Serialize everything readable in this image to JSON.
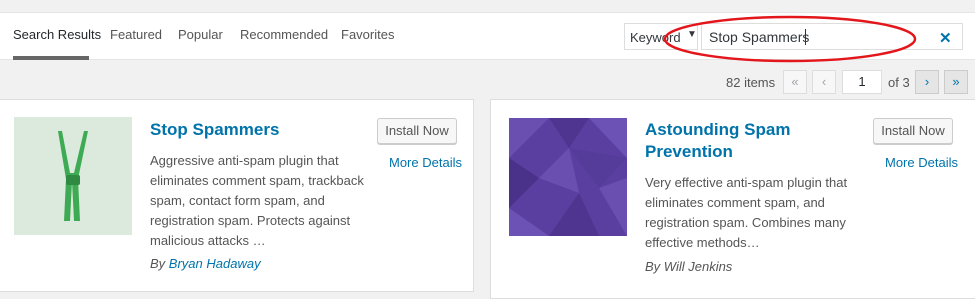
{
  "tabs": [
    {
      "label": "Search Results",
      "active": true
    },
    {
      "label": "Featured",
      "active": false
    },
    {
      "label": "Popular",
      "active": false
    },
    {
      "label": "Recommended",
      "active": false
    },
    {
      "label": "Favorites",
      "active": false
    }
  ],
  "search": {
    "type_selected": "Keyword",
    "value": "Stop Spammers",
    "clear_icon": "close-icon"
  },
  "pagination": {
    "items_count": "82 items",
    "first": "«",
    "prev": "‹",
    "current_page": "1",
    "of_pages": "of 3",
    "next": "›",
    "last": "»"
  },
  "plugins": [
    {
      "title": "Stop Spammers",
      "description_lines": [
        "Aggressive anti-spam plugin that",
        "eliminates comment spam, trackback",
        "spam, contact form spam, and",
        "registration spam. Protects against",
        "malicious attacks …"
      ],
      "author_prefix": "By",
      "author": "Bryan Hadaway",
      "install_label": "Install Now",
      "more_details": "More Details",
      "thumbnail_icon": "suspenders-icon"
    },
    {
      "title_lines": [
        "Astounding Spam",
        "Prevention"
      ],
      "description_lines": [
        "Very effective anti-spam plugin that",
        "eliminates comment spam, and",
        "registration spam. Combines many",
        "effective methods…"
      ],
      "author_prefix": "By",
      "author": "Will Jenkins",
      "install_label": "Install Now",
      "more_details": "More Details",
      "thumbnail_icon": "geometric-pattern-icon"
    }
  ],
  "colors": {
    "link": "#0073aa",
    "highlight": "#e3161b",
    "thumb1_bg": "#dbeadc",
    "thumb1_fg": "#3eab54",
    "thumb2_bg": "#5b3fa0"
  }
}
